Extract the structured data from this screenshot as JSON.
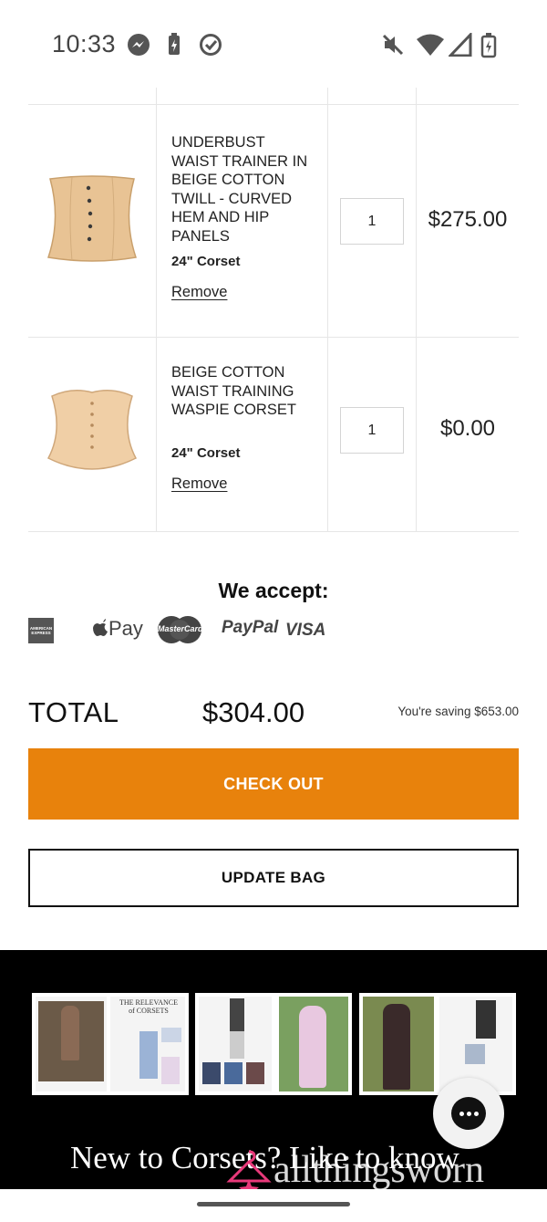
{
  "status_bar": {
    "time": "10:33"
  },
  "cart": {
    "items": [
      {
        "name": "UNDERBUST WAIST TRAINER IN BEIGE COTTON TWILL - CURVED HEM AND HIP PANELS",
        "size": "24\" Corset",
        "remove_label": "Remove",
        "quantity": "1",
        "price": "$275.00"
      },
      {
        "name": "BEIGE COTTON WAIST TRAINING WASPIE CORSET",
        "size": "24\" Corset",
        "remove_label": "Remove",
        "quantity": "1",
        "price": "$0.00"
      }
    ]
  },
  "payments": {
    "heading": "We accept:",
    "methods": [
      "AMERICAN EXPRESS",
      "Pay",
      "MasterCard",
      "PayPal",
      "VISA"
    ]
  },
  "totals": {
    "label": "TOTAL",
    "value": "$304.00",
    "saving": "You're saving $653.00"
  },
  "actions": {
    "checkout_label": "CHECK OUT",
    "update_label": "UPDATE BAG"
  },
  "footer": {
    "magazine_title": "THE RELEVANCE of CORSETS",
    "headline": "New to Corsets? Like to know",
    "watermark": "allthingsworn"
  },
  "colors": {
    "accent": "#e8820c",
    "footer_bg": "#000000",
    "watermark_pink": "#e8397a"
  }
}
